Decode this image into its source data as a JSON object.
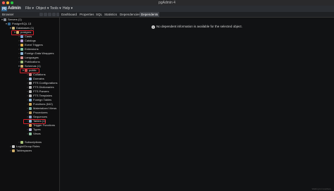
{
  "window": {
    "title": "pgAdmin 4"
  },
  "menubar": {
    "logo": "Admin",
    "items": [
      "File",
      "Object",
      "Tools",
      "Help"
    ]
  },
  "browser": {
    "label": "Browser"
  },
  "tabs": [
    "Dashboard",
    "Properties",
    "SQL",
    "Statistics",
    "Dependencies",
    "Dependents"
  ],
  "active_tab": "Dependents",
  "tree": [
    {
      "label": "Servers (1)"
    },
    {
      "label": "PostgreSQL 13"
    },
    {
      "label": "Databases (1)"
    },
    {
      "label": "postgres"
    },
    {
      "label": "Casts"
    },
    {
      "label": "Catalogs"
    },
    {
      "label": "Event Triggers"
    },
    {
      "label": "Extensions"
    },
    {
      "label": "Foreign Data Wrappers"
    },
    {
      "label": "Languages"
    },
    {
      "label": "Publications"
    },
    {
      "label": "Schemas (1)"
    },
    {
      "label": "public"
    },
    {
      "label": "Collations"
    },
    {
      "label": "Domains"
    },
    {
      "label": "FTS Configurations"
    },
    {
      "label": "FTS Dictionaries"
    },
    {
      "label": "FTS Parsers"
    },
    {
      "label": "FTS Templates"
    },
    {
      "label": "Foreign Tables"
    },
    {
      "label": "Functions (642)"
    },
    {
      "label": "Materialized Views"
    },
    {
      "label": "Procedures"
    },
    {
      "label": "Sequences"
    },
    {
      "label": "Tables (1)"
    },
    {
      "label": "Trigger Functions"
    },
    {
      "label": "Types"
    },
    {
      "label": "Views"
    },
    {
      "label": "Subscriptions"
    },
    {
      "label": "Login/Group Roles"
    },
    {
      "label": "Tablespaces"
    }
  ],
  "main": {
    "message": "No dependent information is available for the selected object."
  },
  "status": "Waiting for localhost..."
}
